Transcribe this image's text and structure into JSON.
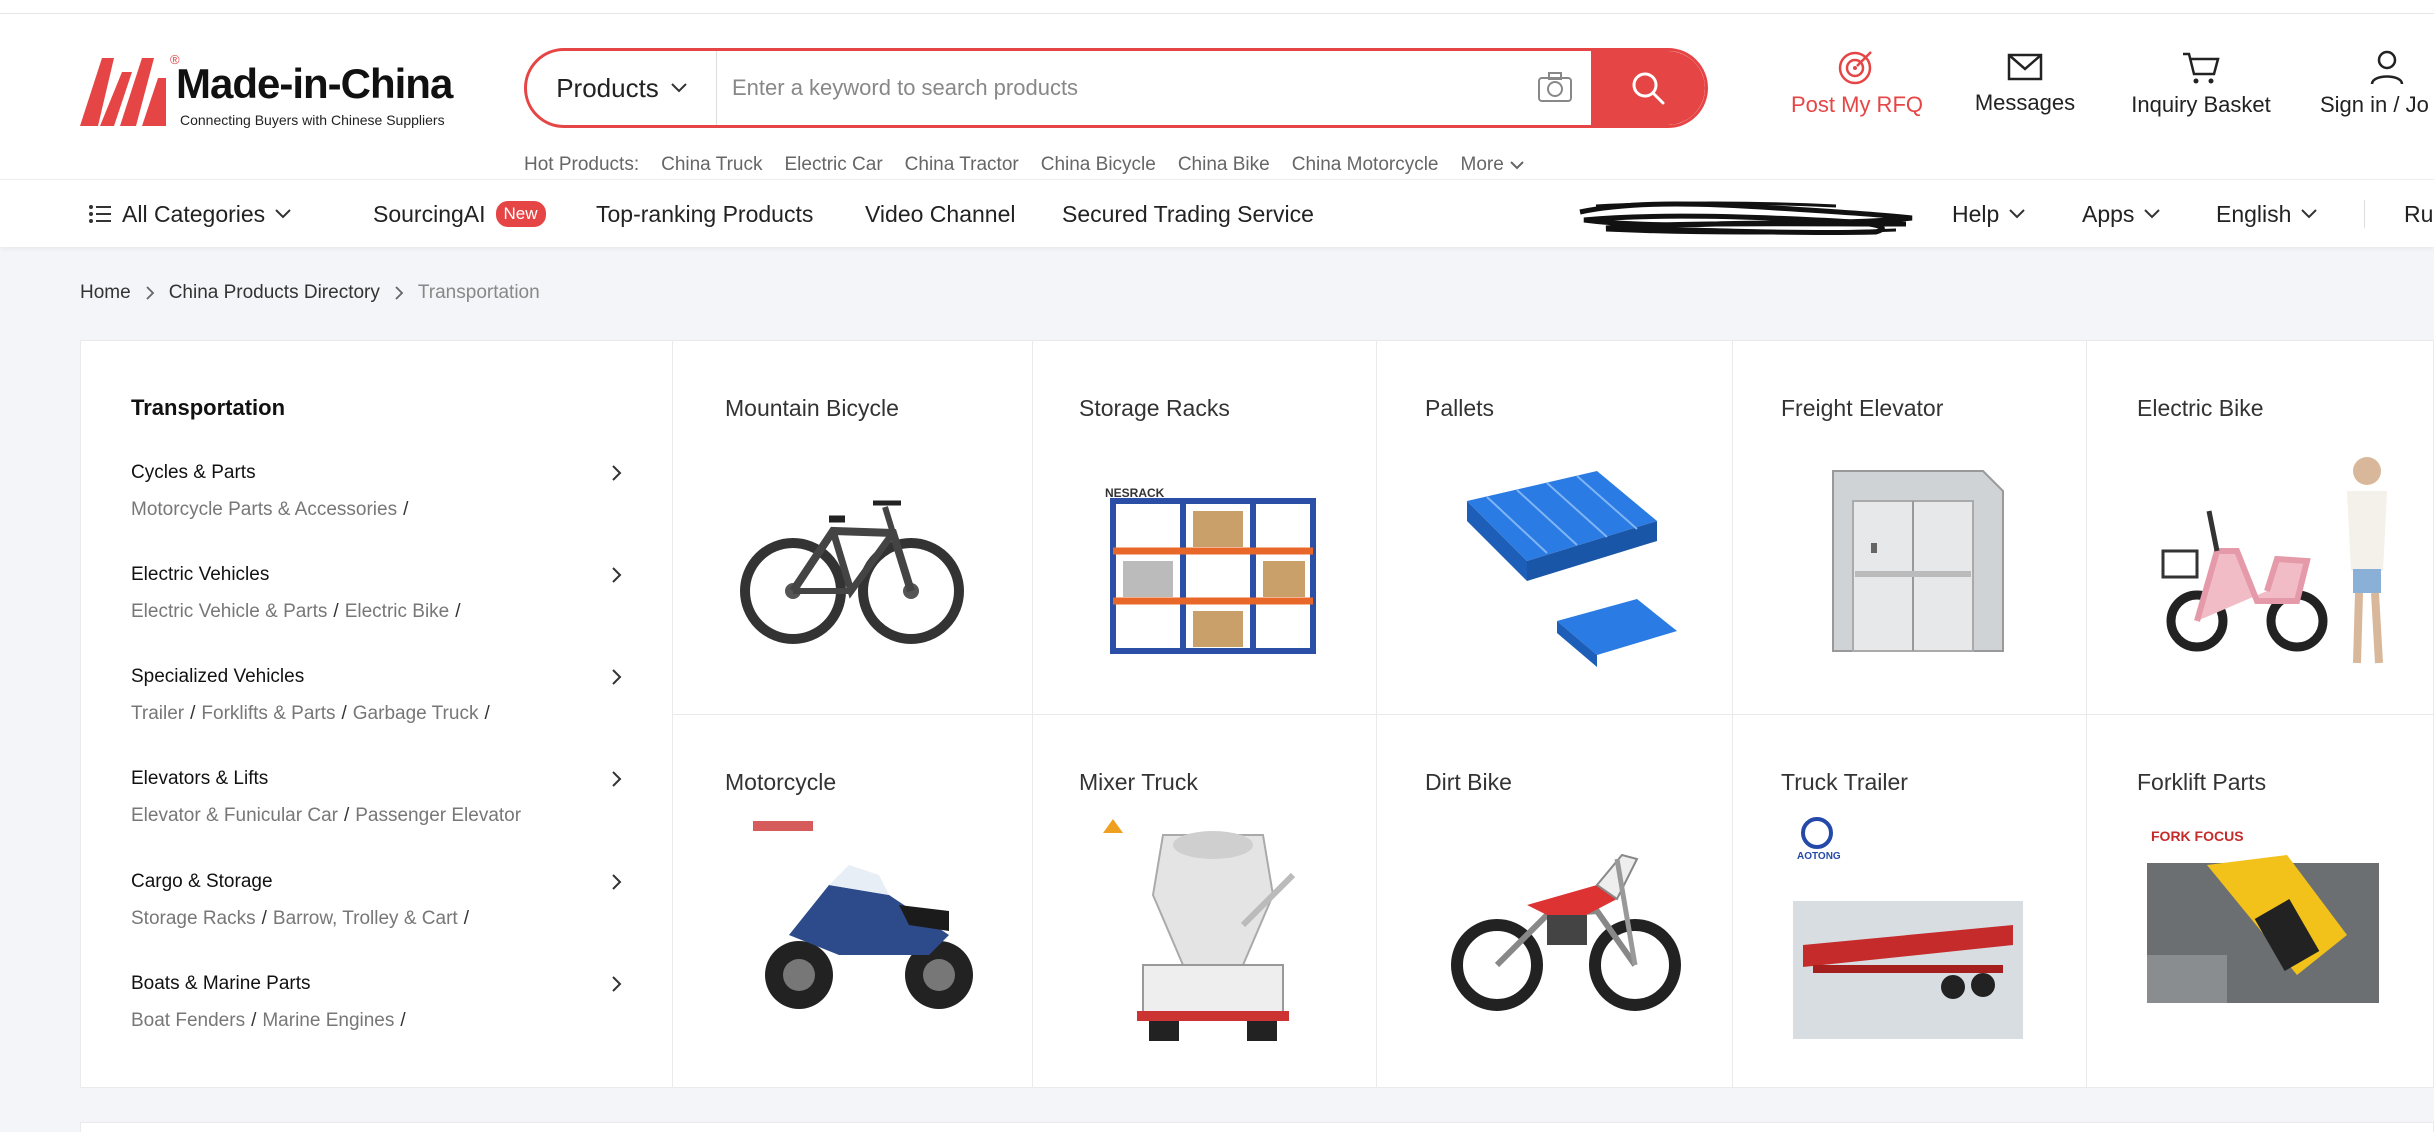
{
  "brand": {
    "name": "Made-in-China",
    "tagline": "Connecting Buyers with Chinese Suppliers",
    "reg": "®",
    "color": "#e64545"
  },
  "search": {
    "category": "Products",
    "placeholder": "Enter a keyword to search products"
  },
  "hot_products": {
    "label": "Hot Products:",
    "items": [
      "China Truck",
      "Electric Car",
      "China Tractor",
      "China Bicycle",
      "China Bike",
      "China Motorcycle"
    ],
    "more": "More"
  },
  "tools": {
    "rfq": "Post My RFQ",
    "messages": "Messages",
    "basket": "Inquiry Basket",
    "sign": "Sign in / Jo"
  },
  "nav": {
    "all_categories": "All Categories",
    "sourcing_ai": "SourcingAI",
    "new_badge": "New",
    "top_ranking": "Top-ranking Products",
    "video": "Video Channel",
    "secured": "Secured Trading Service",
    "help": "Help",
    "apps": "Apps",
    "language": "English",
    "ru": "Ru"
  },
  "breadcrumb": {
    "home": "Home",
    "directory": "China Products Directory",
    "current": "Transportation"
  },
  "sidebar": {
    "title": "Transportation",
    "categories": [
      {
        "name": "Cycles & Parts",
        "subs": [
          "Motorcycle Parts & Accessories"
        ]
      },
      {
        "name": "Electric Vehicles",
        "subs": [
          "Electric Vehicle & Parts",
          "Electric Bike"
        ]
      },
      {
        "name": "Specialized Vehicles",
        "subs": [
          "Trailer",
          "Forklifts & Parts",
          "Garbage Truck"
        ]
      },
      {
        "name": "Elevators & Lifts",
        "subs": [
          "Elevator & Funicular Car",
          "Passenger Elevator"
        ]
      },
      {
        "name": "Cargo & Storage",
        "subs": [
          "Storage Racks",
          "Barrow, Trolley & Cart"
        ]
      },
      {
        "name": "Boats & Marine Parts",
        "subs": [
          "Boat Fenders",
          "Marine Engines"
        ]
      }
    ]
  },
  "products": [
    {
      "title": "Mountain Bicycle"
    },
    {
      "title": "Storage Racks"
    },
    {
      "title": "Pallets"
    },
    {
      "title": "Freight Elevator"
    },
    {
      "title": "Electric Bike"
    },
    {
      "title": "Motorcycle"
    },
    {
      "title": "Mixer Truck"
    },
    {
      "title": "Dirt Bike"
    },
    {
      "title": "Truck Trailer"
    },
    {
      "title": "Forklift Parts"
    }
  ],
  "product_image_text": {
    "racks_brand": "NESRACK",
    "trailer_brand": "AOTONG",
    "forklift_brand": "FORK FOCUS"
  }
}
